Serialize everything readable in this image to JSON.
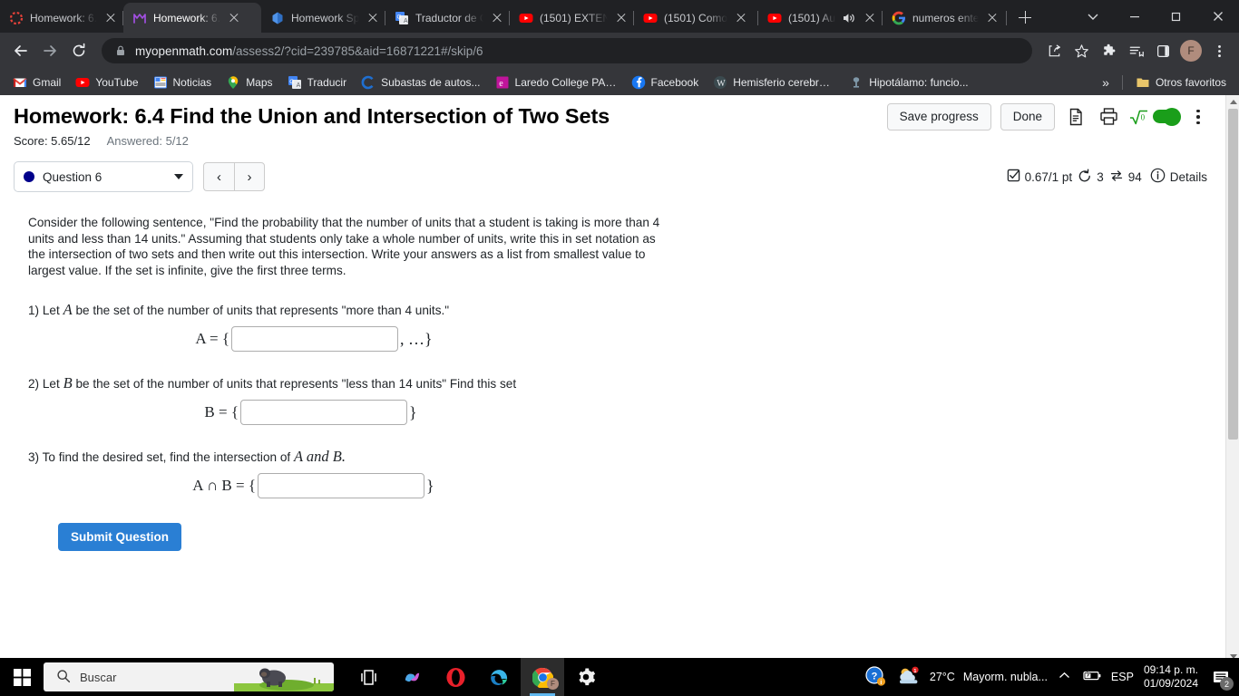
{
  "browser": {
    "tabs": [
      {
        "title": "Homework: 6.",
        "favicon": "canvas-icon",
        "active": false
      },
      {
        "title": "Homework: 6.",
        "favicon": "myopenmath-icon",
        "active": true
      },
      {
        "title": "Homework Sp",
        "favicon": "generic-blue-icon",
        "active": false
      },
      {
        "title": "Traductor de G",
        "favicon": "google-translate-icon",
        "active": false
      },
      {
        "title": "(1501) EXTEN",
        "favicon": "youtube-icon",
        "active": false
      },
      {
        "title": "(1501) Como",
        "favicon": "youtube-icon",
        "active": false
      },
      {
        "title": "(1501) Au",
        "favicon": "youtube-icon",
        "active": false,
        "audio": true
      },
      {
        "title": "numeros ente",
        "favicon": "google-icon",
        "active": false
      }
    ],
    "new_tab_label": "+",
    "window_controls": [
      "tab-search-chevron",
      "minimize",
      "restore",
      "close"
    ],
    "omnibox": {
      "lock_icon": "lock-icon",
      "url_host": "myopenmath.com",
      "url_path": "/assess2/?cid=239785&aid=16871221#/skip/6"
    },
    "toolbar_icons": [
      "share-icon",
      "bookmark-star-icon",
      "extensions-puzzle-icon",
      "reading-list-icon",
      "side-panel-icon"
    ],
    "profile_initial": "F",
    "bookmarks": [
      {
        "label": "Gmail",
        "icon": "gmail-icon"
      },
      {
        "label": "YouTube",
        "icon": "youtube-icon"
      },
      {
        "label": "Noticias",
        "icon": "google-news-icon"
      },
      {
        "label": "Maps",
        "icon": "google-maps-icon"
      },
      {
        "label": "Traducir",
        "icon": "google-translate-icon"
      },
      {
        "label": "Subastas de autos...",
        "icon": "copart-icon"
      },
      {
        "label": "Laredo College PAS...",
        "icon": "laredo-college-icon"
      },
      {
        "label": "Facebook",
        "icon": "facebook-icon"
      },
      {
        "label": "Hemisferio cerebral...",
        "icon": "wikipedia-icon"
      },
      {
        "label": "Hipotálamo: funcio...",
        "icon": "generic-icon"
      }
    ],
    "bookmarks_overflow": "»",
    "other_bookmarks": {
      "label": "Otros favoritos",
      "icon": "folder-icon"
    }
  },
  "assessment": {
    "title": "Homework: 6.4 Find the Union and Intersection of Two Sets",
    "score_label": "Score: 5.65/12",
    "answered_label": "Answered: 5/12",
    "save_progress_label": "Save progress",
    "done_label": "Done",
    "icons": [
      "document-icon",
      "print-icon",
      "math-mode-icon",
      "kebab-menu-icon"
    ],
    "math_mode_on": true,
    "accent_color": "#1a9e1a"
  },
  "question_nav": {
    "selected_question": "Question 6",
    "dot_color": "#00008b",
    "prev_label": "‹",
    "next_label": "›",
    "points": "0.67/1 pt",
    "attempts": "3",
    "views": "94",
    "details_label": "Details"
  },
  "question": {
    "prompt": "Consider the following sentence, \"Find the probability that the number of units that a student is taking is more than 4 units and less than 14 units.\" Assuming that students only take a whole number of units, write this in set notation as the intersection of two sets and then write out this intersection. Write your answers as a list from smallest value to largest value. If the set is infinite, give the first three terms.",
    "parts": [
      {
        "number": "1)",
        "text_before": "Let",
        "var": "A",
        "text_after": "be the set of the number of units that represents \"more than 4 units.\"",
        "equation_lead": "A = {",
        "equation_tail": ", …}",
        "input_value": "",
        "input_width": 184
      },
      {
        "number": "2)",
        "text_before": "Let",
        "var": "B",
        "text_after": "be the set of the number of units that represents \"less than 14 units\" Find this set",
        "equation_lead": "B = {",
        "equation_tail": "}",
        "input_value": "",
        "input_width": 184
      },
      {
        "number": "3)",
        "text_before": "To find the desired set, find the intersection of",
        "var": "A and B.",
        "text_after": "",
        "equation_lead": "A ∩ B = {",
        "equation_tail": "}",
        "input_value": "",
        "input_width": 184
      }
    ],
    "submit_label": "Submit Question"
  },
  "taskbar": {
    "search_placeholder": "Buscar",
    "apps": [
      "task-view-icon",
      "copilot-icon",
      "opera-icon",
      "edge-icon",
      "chrome-icon",
      "settings-icon"
    ],
    "tray": {
      "help_icon": "help-circle-icon",
      "weather_temp": "27°C",
      "weather_text": "Mayorm. nubla...",
      "chevron_icon": "chevron-up-icon",
      "battery_icon": "battery-charging-icon",
      "language": "ESP",
      "time": "09:14 p. m.",
      "date": "01/09/2024",
      "notification_count": "2"
    }
  }
}
